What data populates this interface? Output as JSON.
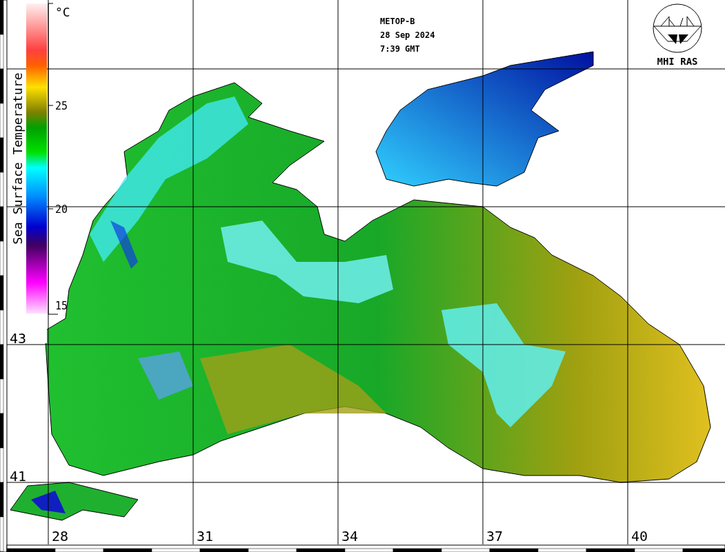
{
  "legend": {
    "title": "Sea Surface Temperature",
    "unit": "°C",
    "ticks": [
      "25",
      "20",
      "15"
    ]
  },
  "info": {
    "satellite": "METOP-B",
    "date": "28 Sep 2024",
    "time": "7:39 GMT"
  },
  "logo": {
    "text": "MHI RAS"
  },
  "latitude_labels": [
    "43",
    "41"
  ],
  "longitude_labels": [
    "28",
    "31",
    "34",
    "37",
    "40"
  ]
}
